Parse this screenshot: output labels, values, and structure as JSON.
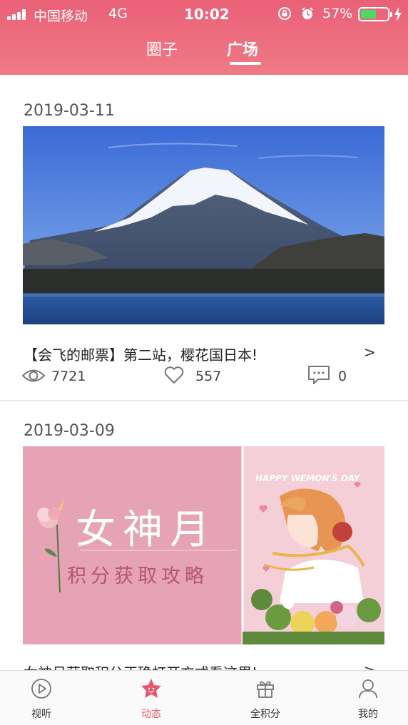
{
  "status_bar": {
    "carrier": "中国移动",
    "network": "4G",
    "time": "10:02",
    "battery_percent": "57%",
    "battery_level": 0.57,
    "battery_color": "#4cd964"
  },
  "header": {
    "tabs": [
      {
        "label": "圈子",
        "active": false
      },
      {
        "label": "广场",
        "active": true
      }
    ],
    "gradient": [
      "#ea6077",
      "#f07a86"
    ]
  },
  "feed": [
    {
      "date": "2019-03-11",
      "image": "mount-fuji-lake-photo",
      "title": "【会飞的邮票】第二站，樱花国日本!",
      "chevron": ">",
      "views": "7721",
      "likes": "557",
      "comments": "0"
    },
    {
      "date": "2019-03-09",
      "image": "goddess-month-banner",
      "banner": {
        "headline": "女神月",
        "subline": "积分获取攻略",
        "happy_text": "HAPPY WEMON'S DAY"
      },
      "title": "女神月获取积分正确打开方式看这里!",
      "chevron": ">"
    }
  ],
  "bottom_nav": [
    {
      "label": "视听",
      "icon": "play-circle-icon",
      "active": false
    },
    {
      "label": "动态",
      "icon": "star-badge-icon",
      "active": true
    },
    {
      "label": "全积分",
      "icon": "gift-icon",
      "active": false
    },
    {
      "label": "我的",
      "icon": "person-icon",
      "active": false
    }
  ],
  "colors": {
    "accent": "#e8566b",
    "banner_pink": "#e7a3b6"
  }
}
